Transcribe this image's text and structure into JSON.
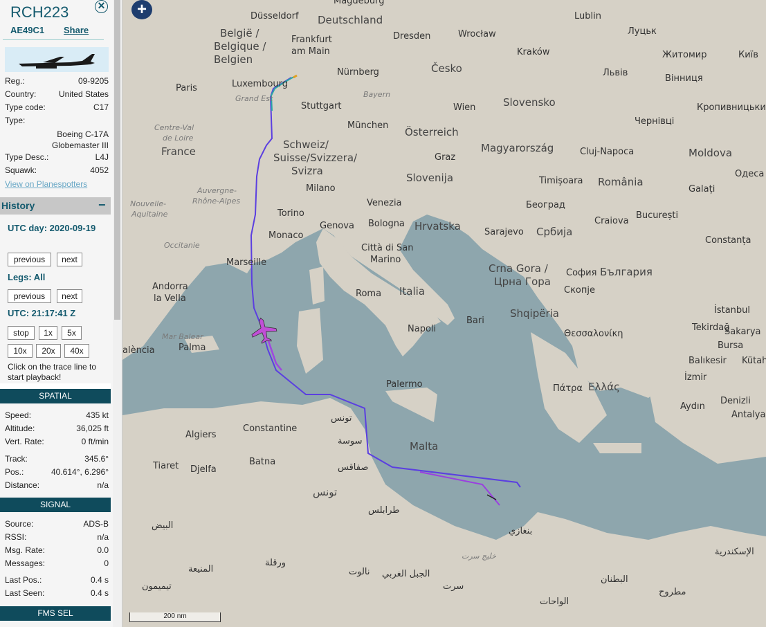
{
  "aircraft": {
    "callsign": "RCH223",
    "hex": "AE49C1",
    "share_label": "Share",
    "close_symbol": "✕",
    "details": [
      {
        "key": "Reg.:",
        "value": "09-9205"
      },
      {
        "key": "Country:",
        "value": "United States"
      },
      {
        "key": "Type code:",
        "value": "C17"
      },
      {
        "key": "Type:",
        "value": ""
      },
      {
        "key": "Type Desc.:",
        "value": "L4J"
      },
      {
        "key": "Squawk:",
        "value": "4052"
      }
    ],
    "type_full": [
      "Boeing C-17A",
      "Globemaster III"
    ],
    "planespotters_link": "View on Planespotters"
  },
  "history": {
    "title": "History",
    "collapse_symbol": "−",
    "utc_day_label": "UTC day: 2020-09-19",
    "prev_label": "previous",
    "next_label": "next",
    "legs_label": "Legs: All",
    "utc_time": "UTC: 21:17:41 Z",
    "speed_buttons": [
      "stop",
      "1x",
      "5x",
      "10x",
      "20x",
      "40x"
    ],
    "hint": "Click on the trace line to start playback!"
  },
  "spatial": {
    "title": "SPATIAL",
    "rows": [
      {
        "key": "Speed:",
        "value": "435 kt"
      },
      {
        "key": "Altitude:",
        "value": "36,025 ft"
      },
      {
        "key": "Vert. Rate:",
        "value": "0 ft/min"
      },
      {
        "key": "Track:",
        "value": "345.6°"
      },
      {
        "key": "Pos.:",
        "value": "40.614°, 6.296°"
      },
      {
        "key": "Distance:",
        "value": "n/a"
      }
    ]
  },
  "signal": {
    "title": "SIGNAL",
    "rows": [
      {
        "key": "Source:",
        "value": "ADS-B"
      },
      {
        "key": "RSSI:",
        "value": "n/a"
      },
      {
        "key": "Msg. Rate:",
        "value": "0.0"
      },
      {
        "key": "Messages:",
        "value": "0"
      },
      {
        "key": "Last Pos.:",
        "value": "0.4 s"
      },
      {
        "key": "Last Seen:",
        "value": "0.4 s"
      }
    ]
  },
  "fms": {
    "title": "FMS SEL"
  },
  "map": {
    "zoom_symbol": "+",
    "scale_label": "200 nm",
    "colors": {
      "sea": "#8ea6ad",
      "land": "#d9d4c9",
      "track_blue": "#5b3fe0",
      "track_purple": "#9a3fe0",
      "plane": "#c04fd6"
    },
    "labels": {
      "magdeburg": "Magdeburg",
      "dusseldorf": "Düsseldorf",
      "deutschland": "Deutschland",
      "lublin": "Lublin",
      "belgie": "België /",
      "belgique": "Belgique /",
      "belgien": "Belgien",
      "frankfurt": "Frankfurt",
      "am_main": "am Main",
      "dresden": "Dresden",
      "wroclaw": "Wrocław",
      "lutsk": "Луцьк",
      "zhytomyr": "Житомир",
      "kyiv": "Київ",
      "luxembourg": "Luxembourg",
      "nurnberg": "Nürnberg",
      "cesko": "Česko",
      "krakow": "Kraków",
      "lviv": "Львів",
      "paris": "Paris",
      "grand_est": "Grand Est",
      "bayern": "Bayern",
      "stuttgart": "Stuttgart",
      "vinnytsia": "Вінниця",
      "wien": "Wien",
      "slovensko": "Slovensko",
      "kropyvnytskyi": "Кропивницький",
      "centre": "Centre-Val",
      "de_loire": "de Loire",
      "munchen": "München",
      "osterreich": "Österreich",
      "chernivtsi": "Чернівці",
      "france": "France",
      "schweiz": "Schweiz/",
      "suisse": "Suisse/Svizzera/",
      "svizra": "Svizra",
      "magyar": "Magyarország",
      "cluj": "Cluj-Napoca",
      "moldova": "Moldova",
      "graz": "Graz",
      "slovenija": "Slovenija",
      "timisoara": "Timişoara",
      "romania": "România",
      "galati": "Galați",
      "odesa": "Одеса",
      "auvergne": "Auvergne-",
      "rhone": "Rhône-Alpes",
      "nouvelle": "Nouvelle-",
      "aquitaine": "Aquitaine",
      "milano": "Milano",
      "venezia": "Venezia",
      "beograd": "Београд",
      "torino": "Torino",
      "genova": "Genova",
      "bologna": "Bologna",
      "hrvatska": "Hrvatska",
      "srbija": "Србија",
      "craiova": "Craiova",
      "bucuresti": "București",
      "constanta": "Constanța",
      "occitanie": "Occitanie",
      "monaco": "Monaco",
      "citta": "Città di San",
      "marino": "Marino",
      "sarajevo": "Sarajevo",
      "marseille": "Marseille",
      "crna": "Crna Gora /",
      "crna2": "Црна Гора",
      "sofia": "София",
      "bulgaria": "България",
      "andorra": "Andorra",
      "la_vella": "la Vella",
      "italia": "Italia",
      "roma": "Roma",
      "skopje": "Скопје",
      "istanbul": "İstanbul",
      "shqiperia": "Shqipëria",
      "bari": "Bari",
      "tekirdag": "Tekirdağ",
      "mar_balear": "Mar Balear",
      "napoli": "Napoli",
      "thessaloniki": "Θεσσαλονίκη",
      "sakarya": "Sakarya",
      "palma": "Palma",
      "valencia": "alència",
      "bursa": "Bursa",
      "balikesir": "Balıkesir",
      "kutahya": "Kütahy",
      "izmir": "İzmir",
      "palermo": "Palermo",
      "patra": "Πάτρα",
      "ellas": "Ελλάς",
      "denizli": "Denizli",
      "tunis": "تونس",
      "aydin": "Aydın",
      "antalya": "Antalya",
      "algiers": "Algiers",
      "constantine": "Constantine",
      "sousse": "سوسة",
      "malta": "Malta",
      "tiaret": "Tiaret",
      "djelfa": "Djelfa",
      "batna": "Batna",
      "sfax": "صفاقس",
      "tunisia": "تونس",
      "tripoli": "طرابلس",
      "bayda": "البيض",
      "benghazi": "بنغازي",
      "alex": "الإسكندرية",
      "sirte_gulf": "خليج سرت",
      "ouargla": "ورقلة",
      "menia": "المنيعة",
      "nalut": "نالوت",
      "jabal": "الجبل الغربي",
      "sirte": "سرت",
      "timimoun": "تيميمون",
      "wahat": "الواحات",
      "bitnan": "البطنان",
      "matruh": "مطروح"
    }
  },
  "chart_data": {
    "type": "map",
    "track_points_latlon": "not printed"
  }
}
